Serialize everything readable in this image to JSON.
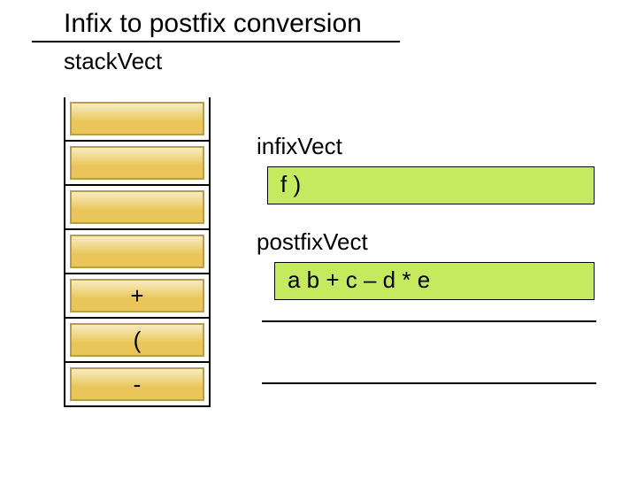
{
  "title": "Infix to postfix conversion",
  "labels": {
    "stack": "stackVect",
    "infix": "infixVect",
    "postfix": "postfixVect"
  },
  "stack": {
    "cells": [
      "",
      "",
      "",
      "",
      "+",
      "(",
      "-"
    ]
  },
  "infix_value": "f )",
  "postfix_value": "a b + c – d * e"
}
